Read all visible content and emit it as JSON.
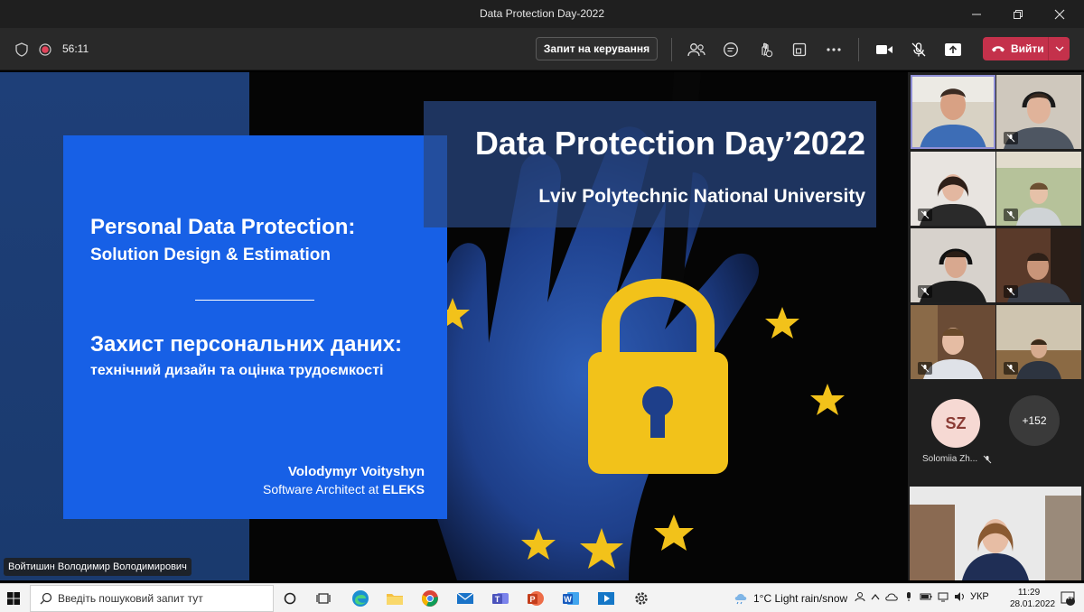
{
  "window": {
    "title": "Data Protection Day-2022"
  },
  "toolbar": {
    "timer": "56:11",
    "request_control_label": "Запит на керування",
    "leave_label": "Вийти"
  },
  "slide": {
    "left_title": "Personal Data Protection:",
    "left_subtitle": "Solution Design & Estimation",
    "ua_title": "Захист персональних даних:",
    "ua_subtitle": "технічний дизайн та оцінка трудоємкості",
    "author": "Volodymyr Voityshyn",
    "author_role_prefix": "Software Architect at ",
    "author_company": "ELEKS",
    "event_title": "Data Protection Day’2022",
    "event_university": "Lviv Polytechnic National University"
  },
  "presenter": {
    "name": "Войтишин Володимир Володимирович"
  },
  "participants": {
    "sz_initials": "SZ",
    "sz_name": "Solomiia Zh...",
    "more_count": "+152"
  },
  "taskbar": {
    "search_placeholder": "Введіть пошуковий запит тут",
    "weather": "1°C  Light rain/snow",
    "language": "УКР",
    "time": "11:29",
    "date": "28.01.2022",
    "notifications": "44"
  },
  "colors": {
    "slide_blue": "#1760e6",
    "leave_red": "#c4314b",
    "toolbar_bg": "#292929"
  }
}
